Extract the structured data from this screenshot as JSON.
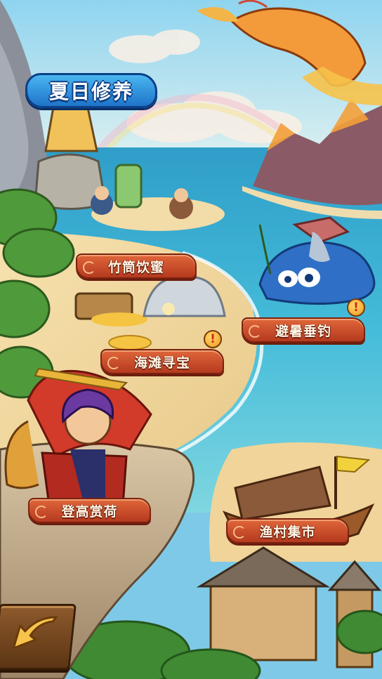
{
  "screen": {
    "title": "夏日修养"
  },
  "locations": [
    {
      "id": "bamboo",
      "label": "竹筒饮蜜",
      "alert": false
    },
    {
      "id": "fishing",
      "label": "避暑垂钓",
      "alert": true
    },
    {
      "id": "treasure",
      "label": "海滩寻宝",
      "alert": true
    },
    {
      "id": "lotus",
      "label": "登高赏荷",
      "alert": false
    },
    {
      "id": "market",
      "label": "渔村集市",
      "alert": false
    }
  ],
  "alert_glyph": "!",
  "controls": {
    "back_icon": "back-arrow-icon"
  },
  "colors": {
    "sea": "#3fb3d6",
    "sand": "#f3d9a0",
    "banner": "#c8472a",
    "title_plaque": "#2b8fe0"
  }
}
